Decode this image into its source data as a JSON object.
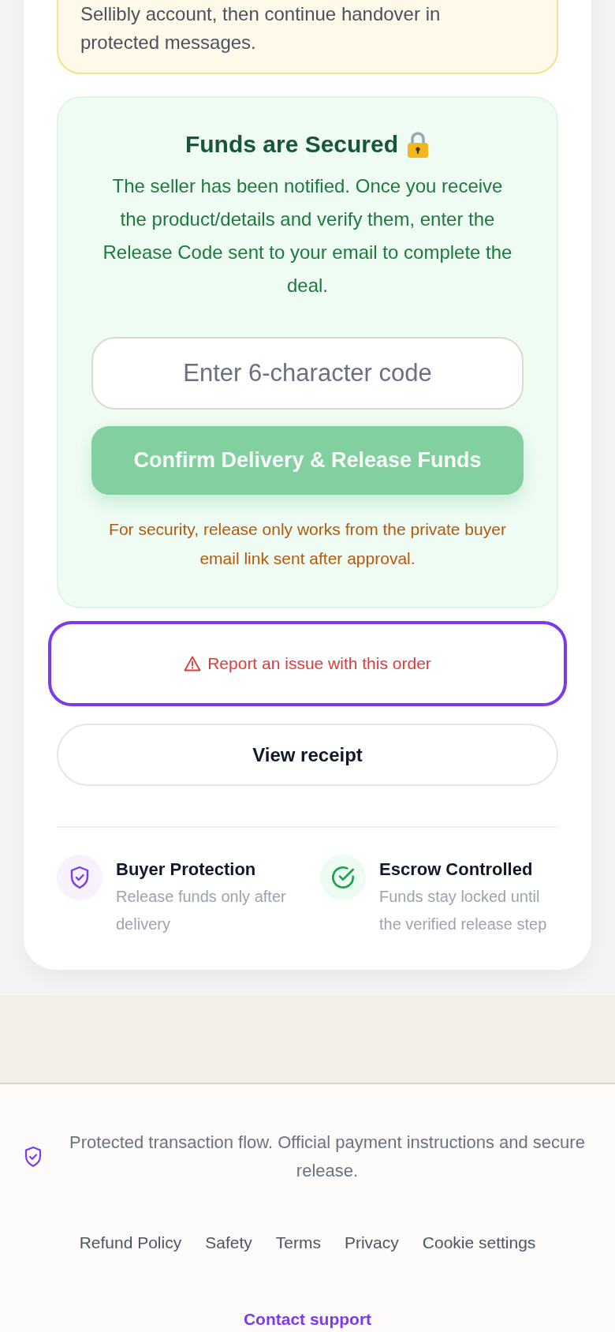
{
  "notice": {
    "text": "Sellibly account, then continue handover in protected messages."
  },
  "escrow_panel": {
    "title": "Funds are Secured",
    "message": "The seller has been notified. Once you receive the product/details and verify them, enter the Release Code sent to your email to complete the deal.",
    "code_field": {
      "placeholder": "Enter 6-character code"
    },
    "confirm_button": {
      "label": "Confirm Delivery & Release Funds",
      "disabled": true
    },
    "security_note": "For security, release only works from the private buyer email link sent after approval."
  },
  "actions": [
    {
      "kind": "report",
      "label": "Report an issue with this order",
      "focused": true
    },
    {
      "kind": "receipt",
      "label": "View receipt",
      "focused": false
    }
  ],
  "features": [
    {
      "kind": "protection",
      "title": "Buyer Protection",
      "description": "Release funds only after delivery"
    },
    {
      "kind": "escrow",
      "title": "Escrow Controlled",
      "description": "Funds stay locked until the verified release step"
    }
  ],
  "footer": {
    "notice": "Protected transaction flow. Official payment instructions and secure release.",
    "links": [
      "Refund Policy",
      "Safety",
      "Terms",
      "Privacy",
      "Cookie settings"
    ],
    "support_link": "Contact support"
  }
}
